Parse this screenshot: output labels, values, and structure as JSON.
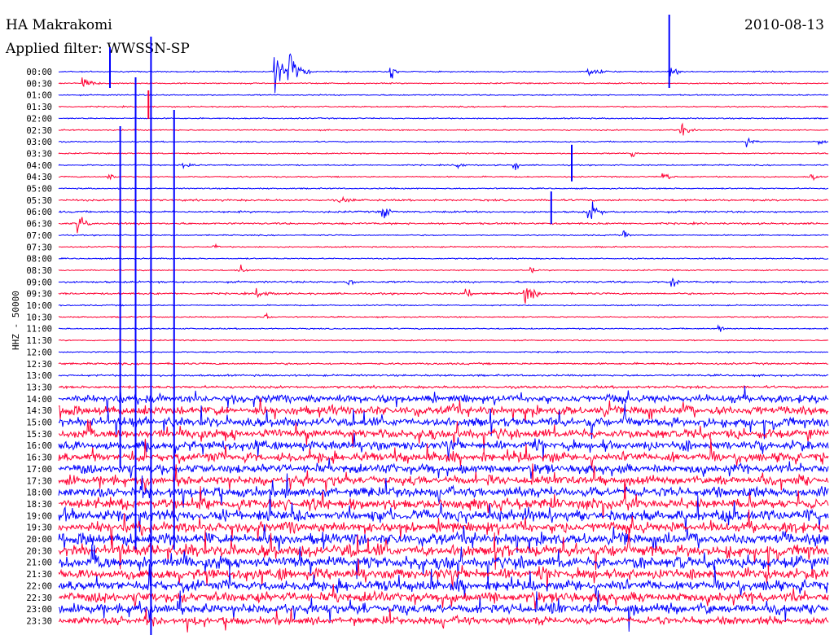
{
  "header": {
    "station": "HA Makrakomi",
    "date": "2010-08-13",
    "filter": "Applied filter: WWSSN-SP"
  },
  "colors": {
    "trace_a": "#0000ff",
    "trace_b": "#ff0033",
    "background": "#ffffff"
  },
  "chart_data": {
    "type": "line",
    "title": "HA Makrakomi",
    "subtitle": "Applied filter: WWSSN-SP",
    "ylabel": "HHZ - 50000",
    "time_labels": [
      "00:00",
      "00:30",
      "01:00",
      "01:30",
      "02:00",
      "02:30",
      "03:00",
      "03:30",
      "04:00",
      "04:30",
      "05:00",
      "05:30",
      "06:00",
      "06:30",
      "07:00",
      "07:30",
      "08:00",
      "08:30",
      "09:00",
      "09:30",
      "10:00",
      "10:30",
      "11:00",
      "11:30",
      "12:00",
      "12:30",
      "13:00",
      "13:30",
      "14:00",
      "14:30",
      "15:00",
      "15:30",
      "16:00",
      "16:30",
      "17:00",
      "17:30",
      "18:00",
      "18:30",
      "19:00",
      "19:30",
      "20:00",
      "20:30",
      "21:00",
      "21:30",
      "22:00",
      "22:30",
      "23:00",
      "23:30"
    ],
    "line_colors": [
      "#0000ff",
      "#ff0033"
    ],
    "noise_level": [
      1,
      1,
      1,
      1,
      1,
      1,
      1,
      1,
      1,
      1,
      1,
      1.5,
      1.5,
      1.5,
      1,
      1,
      1,
      1,
      1.5,
      1.5,
      1,
      1,
      1,
      1,
      1,
      1.5,
      1.5,
      2,
      6,
      7,
      7,
      7,
      7,
      7,
      7,
      7,
      8,
      8,
      8,
      8,
      9,
      9,
      9,
      8,
      8,
      8,
      8,
      6
    ],
    "events": [
      {
        "row": 0,
        "minute": 8.5,
        "amp": 30,
        "dur": 0.5
      },
      {
        "row": 0,
        "minute": 9.0,
        "amp": 32,
        "dur": 0.8
      },
      {
        "row": 0,
        "minute": 13.0,
        "amp": 14,
        "dur": 0.3
      },
      {
        "row": 0,
        "minute": 20.7,
        "amp": 9,
        "dur": 0.8
      },
      {
        "row": 0,
        "minute": 23.9,
        "amp": 10,
        "dur": 0.4
      },
      {
        "row": 1,
        "minute": 1.0,
        "amp": 10,
        "dur": 0.7
      },
      {
        "row": 5,
        "minute": 24.3,
        "amp": 12,
        "dur": 0.5
      },
      {
        "row": 6,
        "minute": 26.9,
        "amp": 9,
        "dur": 0.4
      },
      {
        "row": 6,
        "minute": 29.7,
        "amp": 8,
        "dur": 0.3
      },
      {
        "row": 7,
        "minute": 22.4,
        "amp": 9,
        "dur": 0.3
      },
      {
        "row": 8,
        "minute": 4.9,
        "amp": 7,
        "dur": 0.8
      },
      {
        "row": 8,
        "minute": 15.6,
        "amp": 9,
        "dur": 0.3
      },
      {
        "row": 8,
        "minute": 17.8,
        "amp": 8,
        "dur": 0.3
      },
      {
        "row": 9,
        "minute": 2.0,
        "amp": 7,
        "dur": 0.4
      },
      {
        "row": 9,
        "minute": 23.6,
        "amp": 8,
        "dur": 0.5
      },
      {
        "row": 9,
        "minute": 29.4,
        "amp": 6,
        "dur": 0.3
      },
      {
        "row": 11,
        "minute": 11.0,
        "amp": 5,
        "dur": 0.9
      },
      {
        "row": 12,
        "minute": 12.7,
        "amp": 14,
        "dur": 0.4
      },
      {
        "row": 12,
        "minute": 20.7,
        "amp": 18,
        "dur": 0.6
      },
      {
        "row": 13,
        "minute": 0.8,
        "amp": 16,
        "dur": 0.6
      },
      {
        "row": 14,
        "minute": 22.1,
        "amp": 8,
        "dur": 0.3
      },
      {
        "row": 15,
        "minute": 6.1,
        "amp": 8,
        "dur": 0.2
      },
      {
        "row": 17,
        "minute": 7.1,
        "amp": 8,
        "dur": 0.3
      },
      {
        "row": 17,
        "minute": 18.4,
        "amp": 10,
        "dur": 0.3
      },
      {
        "row": 18,
        "minute": 23.9,
        "amp": 10,
        "dur": 0.4
      },
      {
        "row": 18,
        "minute": 11.3,
        "amp": 6,
        "dur": 0.4
      },
      {
        "row": 19,
        "minute": 7.8,
        "amp": 7,
        "dur": 0.8
      },
      {
        "row": 19,
        "minute": 15.9,
        "amp": 12,
        "dur": 0.4
      },
      {
        "row": 19,
        "minute": 18.2,
        "amp": 16,
        "dur": 0.6
      },
      {
        "row": 21,
        "minute": 8.1,
        "amp": 6,
        "dur": 0.3
      },
      {
        "row": 22,
        "minute": 25.8,
        "amp": 5,
        "dur": 0.3
      }
    ],
    "spikes": [
      {
        "row": 0,
        "minute": 23.8,
        "up": 70,
        "down": 20
      },
      {
        "row": 0,
        "minute": 2.0,
        "up": 30,
        "down": 20
      },
      {
        "row": 3,
        "minute": 3.5,
        "up": 20,
        "down": 15
      },
      {
        "row": 8,
        "minute": 20.0,
        "up": 25,
        "down": 20
      },
      {
        "row": 12,
        "minute": 19.2,
        "up": 25,
        "down": 15
      },
      {
        "row": 20,
        "minute": 3.6,
        "up": 330,
        "down": 420
      },
      {
        "row": 20,
        "minute": 3.0,
        "up": 280,
        "down": 300
      },
      {
        "row": 20,
        "minute": 4.5,
        "up": 240,
        "down": 300
      },
      {
        "row": 20,
        "minute": 2.4,
        "up": 220,
        "down": 200
      }
    ]
  }
}
